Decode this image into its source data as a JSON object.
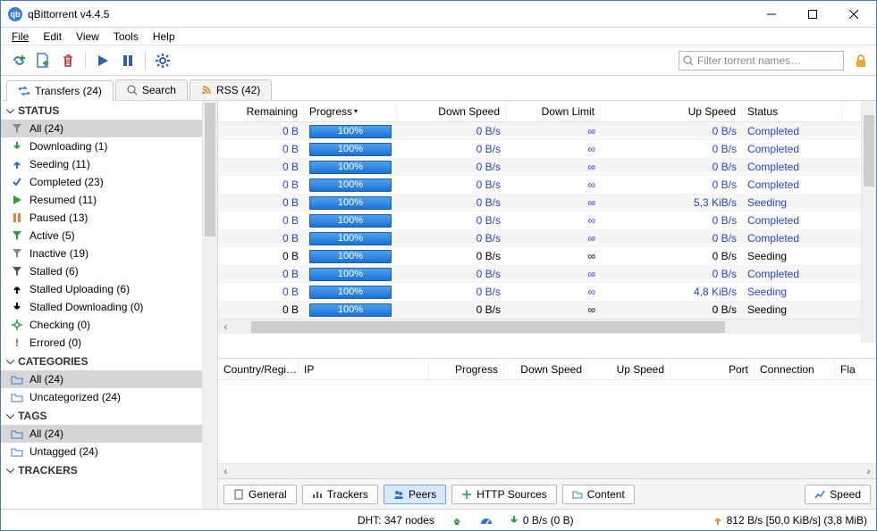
{
  "title": "qBittorrent v4.4.5",
  "menu": {
    "file": "File",
    "edit": "Edit",
    "view": "View",
    "tools": "Tools",
    "help": "Help"
  },
  "toolbar": {
    "filter_placeholder": "Filter torrent names…"
  },
  "tabs": {
    "transfers": "Transfers (24)",
    "search": "Search",
    "rss": "RSS (42)"
  },
  "sidebar": {
    "status_hdr": "STATUS",
    "status": {
      "all": "All (24)",
      "downloading": "Downloading (1)",
      "seeding": "Seeding (11)",
      "completed": "Completed (23)",
      "resumed": "Resumed (11)",
      "paused": "Paused (13)",
      "active": "Active (5)",
      "inactive": "Inactive (19)",
      "stalled": "Stalled (6)",
      "stalled_up": "Stalled Uploading (6)",
      "stalled_down": "Stalled Downloading (0)",
      "checking": "Checking (0)",
      "errored": "Errored (0)"
    },
    "categories_hdr": "CATEGORIES",
    "categories": {
      "all": "All (24)",
      "uncat": "Uncategorized (24)"
    },
    "tags_hdr": "TAGS",
    "tags": {
      "all": "All (24)",
      "untagged": "Untagged (24)"
    },
    "trackers_hdr": "TRACKERS"
  },
  "headers": {
    "remaining": "Remaining",
    "progress": "Progress",
    "dspeed": "Down Speed",
    "dlimit": "Down Limit",
    "uspeed": "Up Speed",
    "status": "Status"
  },
  "rows": [
    {
      "link": true,
      "remaining": "0 B",
      "progress": "100%",
      "dspeed": "0 B/s",
      "dlimit": "∞",
      "uspeed": "0 B/s",
      "status": "Completed"
    },
    {
      "link": true,
      "remaining": "0 B",
      "progress": "100%",
      "dspeed": "0 B/s",
      "dlimit": "∞",
      "uspeed": "0 B/s",
      "status": "Completed"
    },
    {
      "link": true,
      "remaining": "0 B",
      "progress": "100%",
      "dspeed": "0 B/s",
      "dlimit": "∞",
      "uspeed": "0 B/s",
      "status": "Completed"
    },
    {
      "link": true,
      "remaining": "0 B",
      "progress": "100%",
      "dspeed": "0 B/s",
      "dlimit": "∞",
      "uspeed": "0 B/s",
      "status": "Completed"
    },
    {
      "link": true,
      "remaining": "0 B",
      "progress": "100%",
      "dspeed": "0 B/s",
      "dlimit": "∞",
      "uspeed": "5,3 KiB/s",
      "status": "Seeding"
    },
    {
      "link": true,
      "remaining": "0 B",
      "progress": "100%",
      "dspeed": "0 B/s",
      "dlimit": "∞",
      "uspeed": "0 B/s",
      "status": "Completed"
    },
    {
      "link": true,
      "remaining": "0 B",
      "progress": "100%",
      "dspeed": "0 B/s",
      "dlimit": "∞",
      "uspeed": "0 B/s",
      "status": "Completed"
    },
    {
      "link": false,
      "remaining": "0 B",
      "progress": "100%",
      "dspeed": "0 B/s",
      "dlimit": "∞",
      "uspeed": "0 B/s",
      "status": "Seeding"
    },
    {
      "link": true,
      "remaining": "0 B",
      "progress": "100%",
      "dspeed": "0 B/s",
      "dlimit": "∞",
      "uspeed": "0 B/s",
      "status": "Completed"
    },
    {
      "link": true,
      "remaining": "0 B",
      "progress": "100%",
      "dspeed": "0 B/s",
      "dlimit": "∞",
      "uspeed": "4,8 KiB/s",
      "status": "Seeding"
    },
    {
      "link": false,
      "remaining": "0 B",
      "progress": "100%",
      "dspeed": "0 B/s",
      "dlimit": "∞",
      "uspeed": "0 B/s",
      "status": "Seeding"
    }
  ],
  "peers_headers": {
    "country": "Country/Regi…",
    "ip": "IP",
    "progress": "Progress",
    "dspeed": "Down Speed",
    "uspeed": "Up Speed",
    "port": "Port",
    "connection": "Connection",
    "fla": "Fla"
  },
  "btabs": {
    "general": "General",
    "trackers": "Trackers",
    "peers": "Peers",
    "http": "HTTP Sources",
    "content": "Content",
    "speed": "Speed"
  },
  "status": {
    "dht": "DHT: 347 nodes",
    "down": "0 B/s (0 B)",
    "up": "812 B/s [50,0 KiB/s] (3,8 MiB)"
  }
}
